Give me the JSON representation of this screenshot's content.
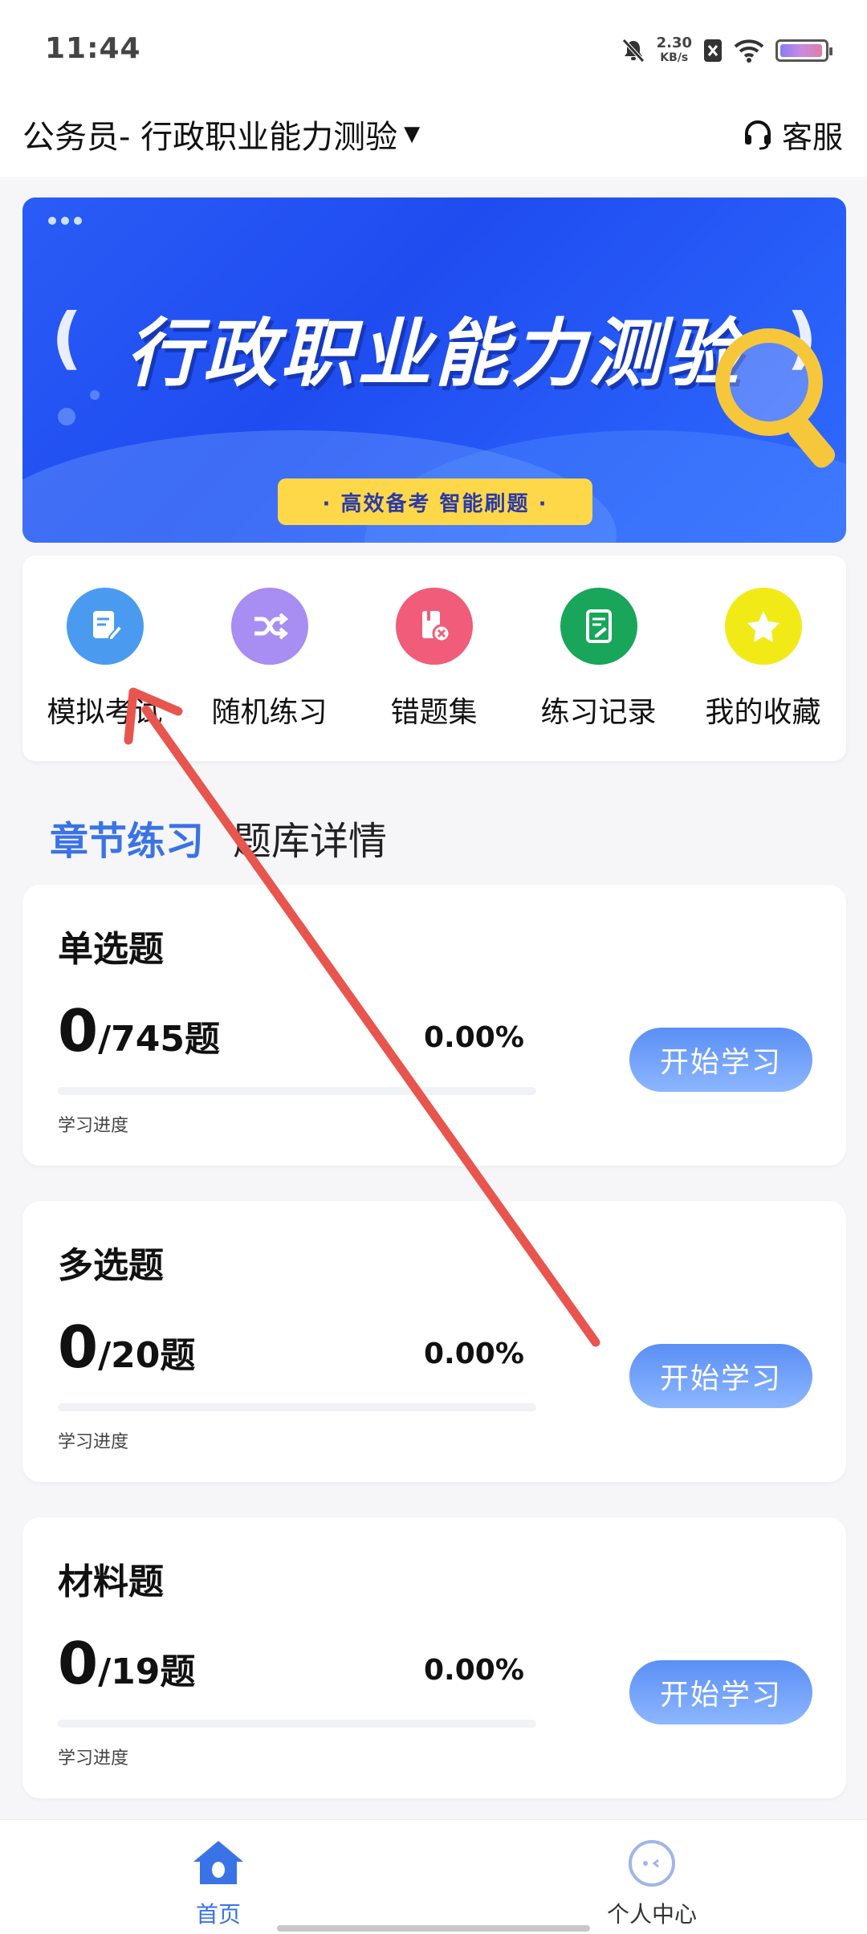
{
  "status_bar": {
    "time": "11:44",
    "net_speed_value": "2.30",
    "net_speed_unit": "KB/s"
  },
  "header": {
    "title": "公务员- 行政职业能力测验",
    "service_label": "客服"
  },
  "banner": {
    "headline": "行政职业能力测验",
    "slogan": "· 高效备考   智能刷题 ·"
  },
  "quick_actions": [
    {
      "label": "模拟考试",
      "color": "#4a9bf0",
      "icon": "exam-paper-icon"
    },
    {
      "label": "随机练习",
      "color": "#a88df2",
      "icon": "shuffle-icon"
    },
    {
      "label": "错题集",
      "color": "#f05c79",
      "icon": "wrong-book-icon"
    },
    {
      "label": "练习记录",
      "color": "#19a55a",
      "icon": "record-icon"
    },
    {
      "label": "我的收藏",
      "color": "#f2ea16",
      "icon": "star-icon"
    }
  ],
  "tabs": {
    "active": "章节练习",
    "inactive": "题库详情"
  },
  "question_banks": [
    {
      "title": "单选题",
      "done": "0",
      "total": "/745题",
      "percent": "0.00%",
      "progress_fraction": 0,
      "progress_label": "学习进度",
      "button": "开始学习"
    },
    {
      "title": "多选题",
      "done": "0",
      "total": "/20题",
      "percent": "0.00%",
      "progress_fraction": 0,
      "progress_label": "学习进度",
      "button": "开始学习"
    },
    {
      "title": "材料题",
      "done": "0",
      "total": "/19题",
      "percent": "0.00%",
      "progress_fraction": 0,
      "progress_label": "学习进度",
      "button": "开始学习"
    }
  ],
  "tab_bar": {
    "home": "首页",
    "profile": "个人中心"
  },
  "colors": {
    "accent": "#3a73e6",
    "annotation_arrow": "#e8554e"
  }
}
